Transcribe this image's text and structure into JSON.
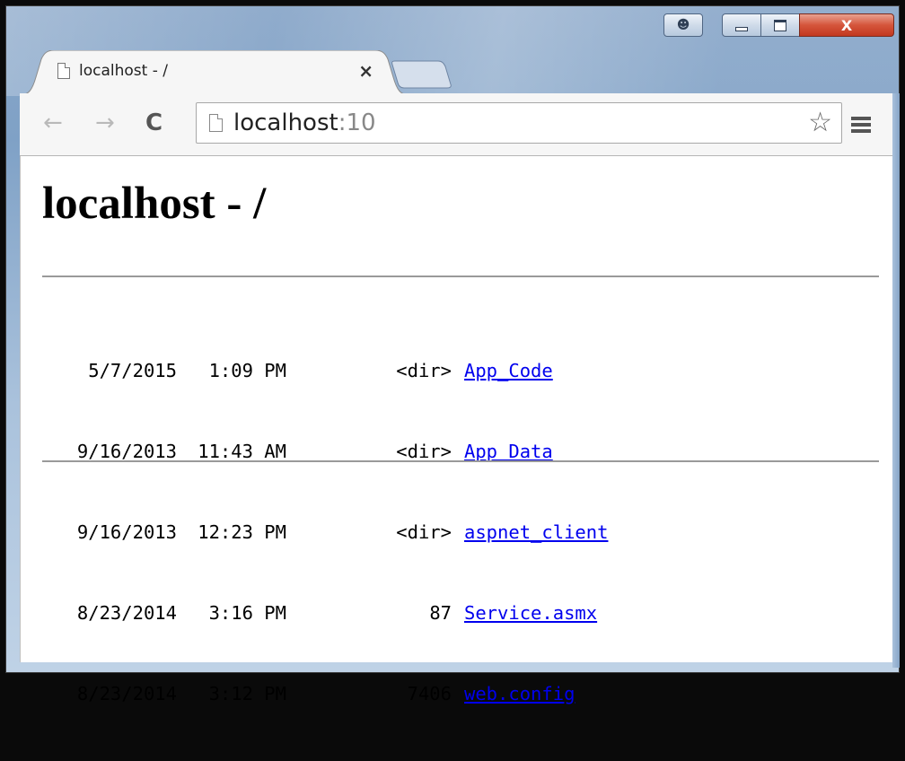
{
  "window": {
    "close_glyph": "X"
  },
  "tab": {
    "title": "localhost - /",
    "close_glyph": "×"
  },
  "toolbar": {
    "back_glyph": "←",
    "forward_glyph": "→",
    "reload_glyph": "C",
    "address_host": "localhost",
    "address_port": ":10",
    "star_glyph": "☆"
  },
  "page": {
    "heading": "localhost - /",
    "entries": [
      {
        "date": "5/7/2015",
        "time": "1:09 PM",
        "size": "<dir>",
        "name": "App_Code"
      },
      {
        "date": "9/16/2013",
        "time": "11:43 AM",
        "size": "<dir>",
        "name": "App_Data"
      },
      {
        "date": "9/16/2013",
        "time": "12:23 PM",
        "size": "<dir>",
        "name": "aspnet_client"
      },
      {
        "date": "8/23/2014",
        "time": "3:16 PM",
        "size": "87",
        "name": "Service.asmx"
      },
      {
        "date": "8/23/2014",
        "time": "3:12 PM",
        "size": "7406",
        "name": "web.config"
      }
    ]
  },
  "icons": {
    "tab_favicon": "page-icon",
    "omnibox_icon": "page-icon",
    "user": "user-icon",
    "minimize": "minimize-icon",
    "maximize": "maximize-icon",
    "close": "close-icon",
    "bookmark": "star-icon",
    "menu": "hamburger-menu-icon"
  },
  "colors": {
    "link": "#0000ee",
    "close_button": "#c2381f",
    "frame": "#7fa1c6"
  }
}
